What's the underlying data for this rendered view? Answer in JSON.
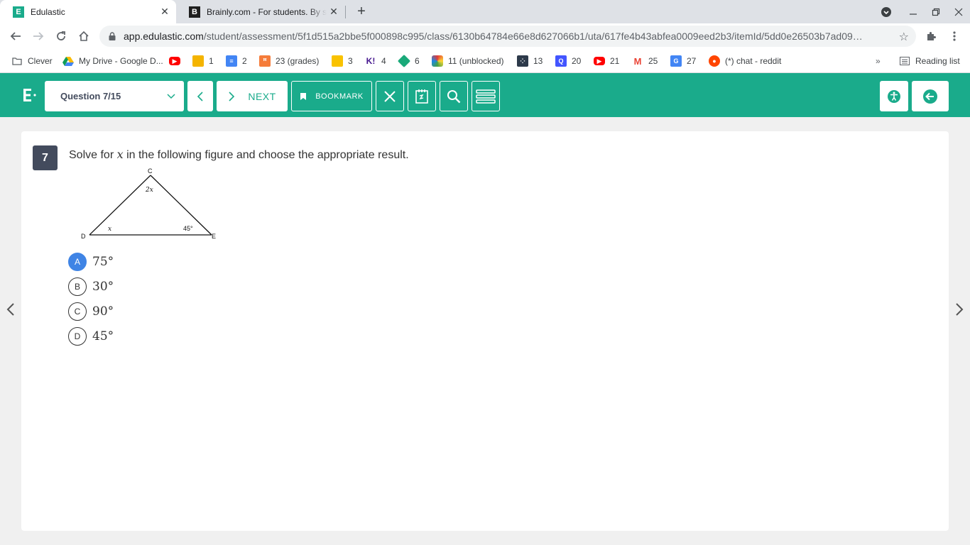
{
  "browser": {
    "tabs": [
      {
        "title": "Edulastic",
        "favicon": "edulastic-icon",
        "active": true
      },
      {
        "title": "Brainly.com - For students. By students.",
        "favicon": "brainly-icon",
        "active": false
      }
    ],
    "url_host": "app.edulastic.com",
    "url_path": "/student/assessment/5f1d515a2bbe5f000898c995/class/6130b64784e66e8d627066b1/uta/617fe4b43abfea0009eed2b3/itemId/5dd0e26503b7ad09…",
    "bookmarks": [
      {
        "label": "Clever",
        "icon": "folder-icon"
      },
      {
        "label": "My Drive - Google D...",
        "icon": "google-drive-icon"
      },
      {
        "label": "",
        "icon": "youtube-icon"
      },
      {
        "label": "1",
        "icon": "google-slides-icon"
      },
      {
        "label": "2",
        "icon": "google-docs-icon"
      },
      {
        "label": "23 (grades)",
        "icon": "grades-icon"
      },
      {
        "label": "3",
        "icon": "classroom-icon"
      },
      {
        "label": "4",
        "icon": "kahoot-icon"
      },
      {
        "label": "6",
        "icon": "app-icon"
      },
      {
        "label": "11 (unblocked)",
        "icon": "game-icon"
      },
      {
        "label": "13",
        "icon": "grid-icon"
      },
      {
        "label": "20",
        "icon": "quizlet-icon"
      },
      {
        "label": "21",
        "icon": "youtube-icon"
      },
      {
        "label": "25",
        "icon": "gmail-icon"
      },
      {
        "label": "27",
        "icon": "translate-icon"
      },
      {
        "label": "(*) chat - reddit",
        "icon": "reddit-icon"
      }
    ],
    "reading_list_label": "Reading list"
  },
  "header": {
    "question_select": "Question 7/15",
    "next_label": "NEXT",
    "bookmark_label": "BOOKMARK"
  },
  "question": {
    "number": "7",
    "text_before": "Solve for",
    "variable": "x",
    "text_after": "in the following figure and choose the appropriate result.",
    "figure": {
      "vertex_c": "C",
      "vertex_d": "D",
      "vertex_e": "E",
      "angle_c": "2x",
      "angle_d": "x",
      "angle_e": "45°"
    },
    "choices": [
      {
        "letter": "A",
        "text": "75°",
        "selected": true
      },
      {
        "letter": "B",
        "text": "30°",
        "selected": false
      },
      {
        "letter": "C",
        "text": "90°",
        "selected": false
      },
      {
        "letter": "D",
        "text": "45°",
        "selected": false
      }
    ]
  },
  "colors": {
    "brand": "#1aab8b",
    "selected_choice": "#3f84e5",
    "question_badge": "#434b5d"
  }
}
